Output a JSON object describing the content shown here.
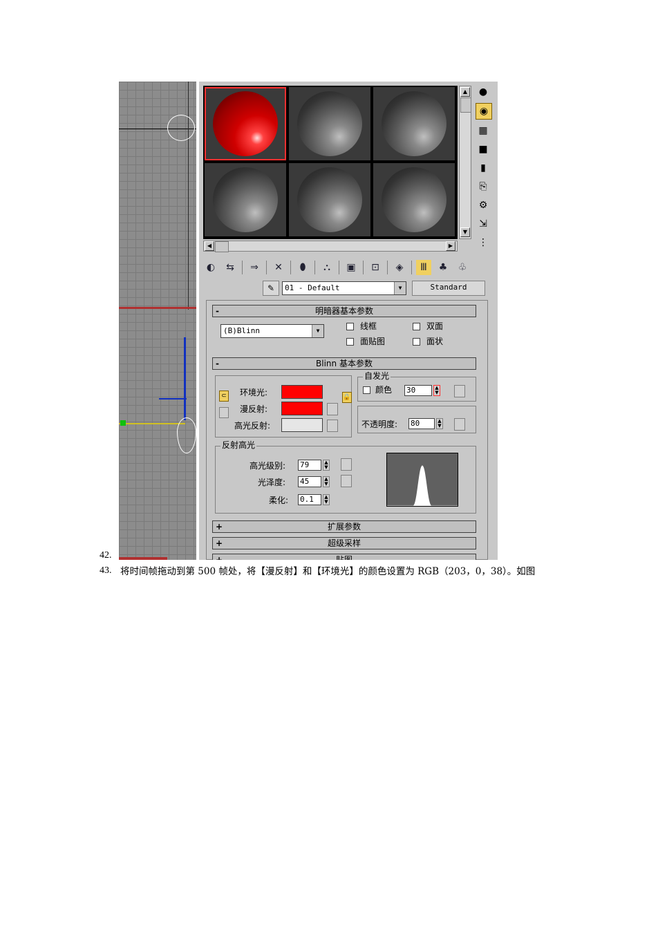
{
  "steps": [
    {
      "num": "42.",
      "text": ""
    },
    {
      "num": "43.",
      "text": "将时间帧拖动到第 500 帧处，将【漫反射】和【环境光】的颜色设置为 RGB（203，0，38）。如图"
    }
  ],
  "material_editor": {
    "material_name": "01 - Default",
    "material_type_button": "Standard",
    "shader_rollout": {
      "sign": "-",
      "title": "明暗器基本参数",
      "shader": "(B)Blinn",
      "options": [
        "线框",
        "双面",
        "面贴图",
        "面状"
      ]
    },
    "blinn_rollout": {
      "sign": "-",
      "title": "Blinn 基本参数",
      "ambient_label": "环境光:",
      "diffuse_label": "漫反射:",
      "specular_label": "高光反射:",
      "self_illum_group": "自发光",
      "self_illum_color_label": "颜色",
      "self_illum_value": "30",
      "opacity_label": "不透明度:",
      "opacity_value": "80",
      "ambient_color": "#ff0000",
      "diffuse_color": "#ff0000",
      "specular_color": "#e6e6e6"
    },
    "specular_highlights": {
      "group": "反射高光",
      "level_label": "高光级别:",
      "level_value": "79",
      "gloss_label": "光泽度:",
      "gloss_value": "45",
      "soften_label": "柔化:",
      "soften_value": "0.1"
    },
    "collapsed_rollouts": [
      {
        "sign": "+",
        "title": "扩展参数"
      },
      {
        "sign": "+",
        "title": "超级采样"
      },
      {
        "sign": "+",
        "title": "贴图"
      }
    ]
  }
}
